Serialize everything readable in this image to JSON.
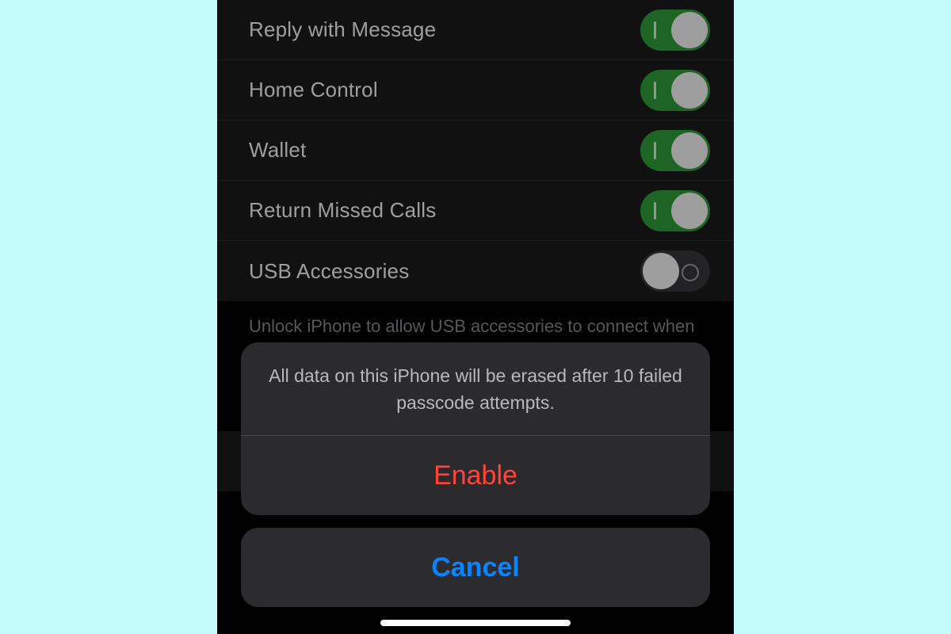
{
  "settings": {
    "items": [
      {
        "label": "Reply with Message",
        "on": true
      },
      {
        "label": "Home Control",
        "on": true
      },
      {
        "label": "Wallet",
        "on": true
      },
      {
        "label": "Return Missed Calls",
        "on": true
      },
      {
        "label": "USB Accessories",
        "on": false
      }
    ],
    "footer": "Unlock iPhone to allow USB accessories to connect when it"
  },
  "sheet": {
    "message": "All data on this iPhone will be erased after 10 failed passcode attempts.",
    "enable": "Enable",
    "cancel": "Cancel"
  }
}
